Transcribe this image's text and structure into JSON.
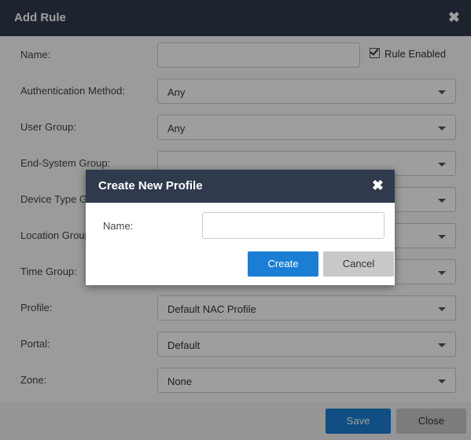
{
  "dialog": {
    "title": "Add Rule",
    "rule_enabled_label": "Rule Enabled",
    "rows": [
      {
        "label": "Name:",
        "value": ""
      },
      {
        "label": "Authentication Method:",
        "value": "Any"
      },
      {
        "label": "User Group:",
        "value": "Any"
      },
      {
        "label": "End-System Group:",
        "value": ""
      },
      {
        "label": "Device Type Group:",
        "value": ""
      },
      {
        "label": "Location Group:",
        "value": ""
      },
      {
        "label": "Time Group:",
        "value": ""
      },
      {
        "label": "Profile:",
        "value": "Default NAC Profile"
      },
      {
        "label": "Portal:",
        "value": "Default"
      },
      {
        "label": "Zone:",
        "value": "None"
      }
    ],
    "save_label": "Save",
    "close_label": "Close"
  },
  "modal": {
    "title": "Create New Profile",
    "name_label": "Name:",
    "name_value": "",
    "create_label": "Create",
    "cancel_label": "Cancel"
  },
  "icons": {
    "close": "close-icon",
    "caret": "chevron-down-icon",
    "checkbox": "checkbox-checked-icon"
  },
  "colors": {
    "titlebar": "#2f3b4d",
    "primary": "#1a7fd4"
  }
}
